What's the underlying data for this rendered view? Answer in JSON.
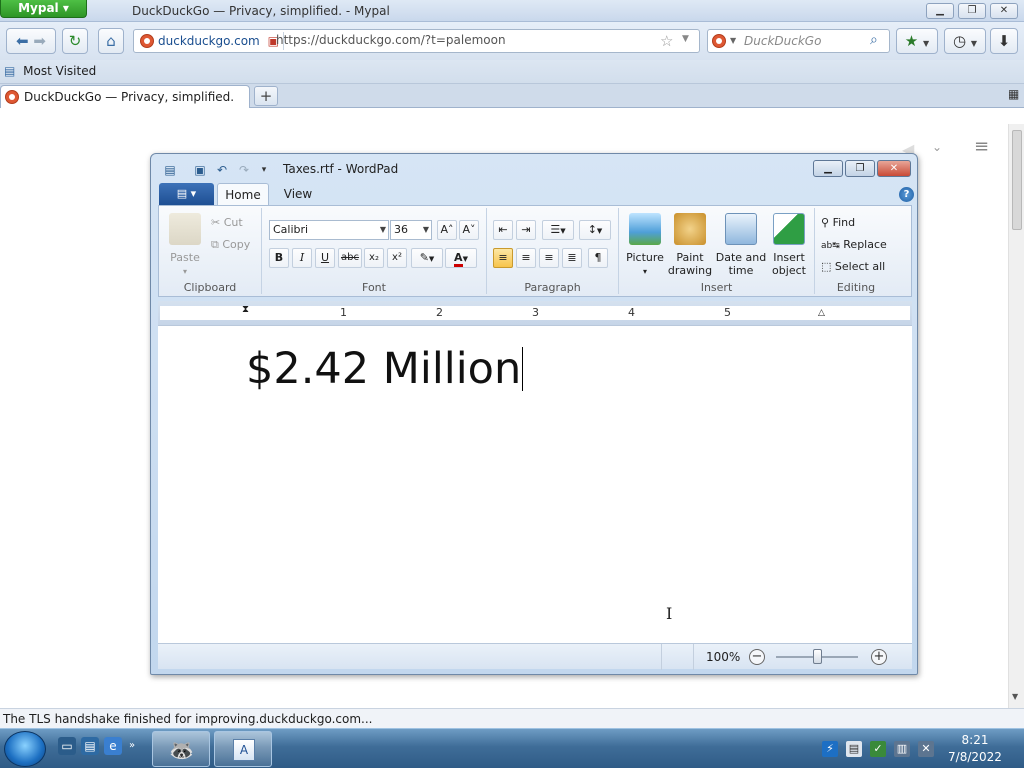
{
  "browser": {
    "app_button": "Mypal",
    "window_title": "DuckDuckGo — Privacy, simplified. - Mypal",
    "site_identity": "duckduckgo.com",
    "url": "https://duckduckgo.com/?t=palemoon",
    "search_placeholder": "DuckDuckGo",
    "bookmarks": [
      {
        "label": "Most Visited"
      }
    ],
    "tabs": [
      {
        "title": "DuckDuckGo — Privacy, simplified."
      }
    ],
    "status": "The TLS handshake finished for improving.duckduckgo.com..."
  },
  "wordpad": {
    "title": "Taxes.rtf - WordPad",
    "tabs": [
      "Home",
      "View"
    ],
    "clipboard": {
      "paste": "Paste",
      "cut": "Cut",
      "copy": "Copy",
      "label": "Clipboard"
    },
    "font": {
      "family": "Calibri",
      "size": "36",
      "label": "Font"
    },
    "paragraph": {
      "label": "Paragraph"
    },
    "insert": {
      "label": "Insert",
      "picture": "Picture",
      "paint_line1": "Paint",
      "paint_line2": "drawing",
      "datetime_line1": "Date and",
      "datetime_line2": "time",
      "object_line1": "Insert",
      "object_line2": "object"
    },
    "editing": {
      "label": "Editing",
      "find": "Find",
      "replace": "Replace",
      "select_all": "Select all"
    },
    "ruler_numbers": [
      "1",
      "2",
      "3",
      "4",
      "5"
    ],
    "document_text": "$2.42 Million",
    "zoom": "100%"
  },
  "taskbar": {
    "time": "8:21",
    "date": "7/8/2022"
  },
  "colors": {
    "mypal_green": "#2d9526",
    "ddg_orange": "#de5833",
    "taskbar_blue": "#3f6d98"
  }
}
